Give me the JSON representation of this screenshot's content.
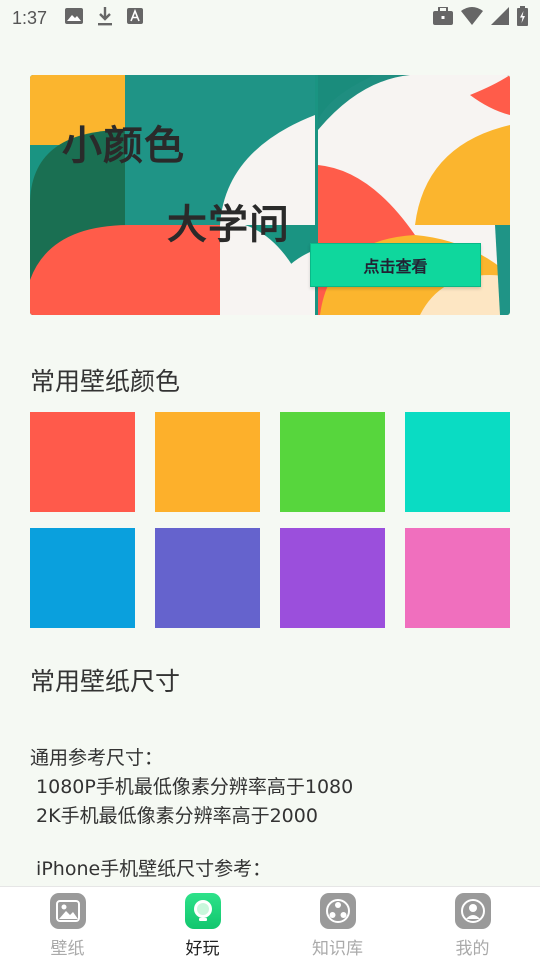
{
  "status_bar": {
    "time": "1:37"
  },
  "banner": {
    "title_line1": "小颜色",
    "title_line2": "大学问",
    "button_label": "点击查看"
  },
  "colors_section": {
    "title": "常用壁纸颜色",
    "swatches": [
      "#ff5a4b",
      "#fdb02b",
      "#57d63d",
      "#0adcc3",
      "#0aa0dd",
      "#6563cd",
      "#9b4fdc",
      "#f06fbe"
    ]
  },
  "sizes_section": {
    "title": "常用壁纸尺寸",
    "lines": [
      "通用参考尺寸：",
      " 1080P手机最低像素分辨率高于1080",
      " 2K手机最低像素分辨率高于2000",
      " iPhone手机壁纸尺寸参考："
    ]
  },
  "bottom_nav": {
    "items": [
      {
        "label": "壁纸",
        "icon": "image-icon",
        "active": false
      },
      {
        "label": "好玩",
        "icon": "bulb-icon",
        "active": true
      },
      {
        "label": "知识库",
        "icon": "knowledge-icon",
        "active": false
      },
      {
        "label": "我的",
        "icon": "user-icon",
        "active": false
      }
    ]
  },
  "colors": {
    "accent": "#12c66e",
    "button": "#0fd79d"
  }
}
